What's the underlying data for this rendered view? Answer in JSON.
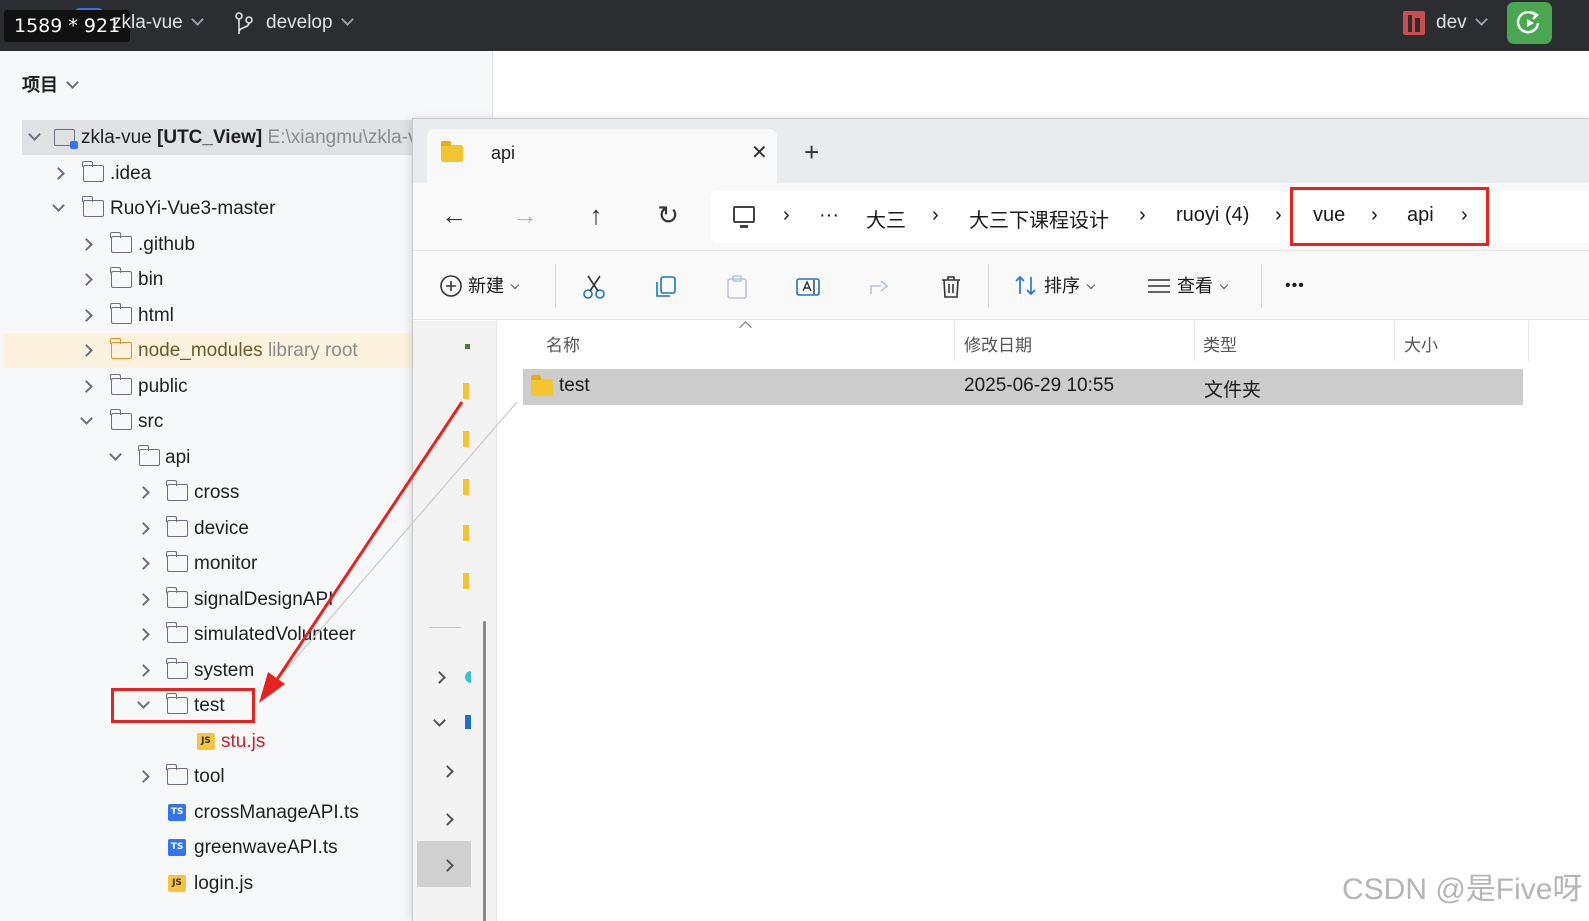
{
  "overlay": {
    "size_label": "1589 * 921"
  },
  "titlebar": {
    "project_name": "zkla-vue",
    "branch": "develop",
    "run_config": "dev",
    "icons": [
      "project-logo-icon",
      "branch-icon",
      "run-config-icon",
      "run-button-icon"
    ]
  },
  "project_panel": {
    "header": "项目",
    "tree": [
      {
        "name": "zkla-vue",
        "bold_suffix": "[UTC_View]",
        "path": "E:\\xiangmu\\zkla-v",
        "level": 0,
        "expanded": true,
        "selected": true
      },
      {
        "name": ".idea",
        "level": 1,
        "expanded": false
      },
      {
        "name": "RuoYi-Vue3-master",
        "level": 1,
        "expanded": true
      },
      {
        "name": ".github",
        "level": 2,
        "expanded": false
      },
      {
        "name": "bin",
        "level": 2,
        "expanded": false
      },
      {
        "name": "html",
        "level": 2,
        "expanded": false
      },
      {
        "name": "node_modules",
        "suffix": "library root",
        "level": 2,
        "expanded": false
      },
      {
        "name": "public",
        "level": 2,
        "expanded": false
      },
      {
        "name": "src",
        "level": 2,
        "expanded": true
      },
      {
        "name": "api",
        "level": 3,
        "expanded": true
      },
      {
        "name": "cross",
        "level": 4,
        "expanded": false
      },
      {
        "name": "device",
        "level": 4,
        "expanded": false
      },
      {
        "name": "monitor",
        "level": 4,
        "expanded": false
      },
      {
        "name": "signalDesignAPI",
        "level": 4,
        "expanded": false
      },
      {
        "name": "simulatedVolunteer",
        "level": 4,
        "expanded": false
      },
      {
        "name": "system",
        "level": 4,
        "expanded": false
      },
      {
        "name": "test",
        "level": 4,
        "expanded": true,
        "highlighted": true
      },
      {
        "name": "stu.js",
        "level": 5,
        "type": "js"
      },
      {
        "name": "tool",
        "level": 4,
        "expanded": false
      },
      {
        "name": "crossManageAPI.ts",
        "level": 4,
        "type": "ts"
      },
      {
        "name": "greenwaveAPI.ts",
        "level": 4,
        "type": "ts"
      },
      {
        "name": "login.js",
        "level": 4,
        "type": "js"
      }
    ]
  },
  "explorer": {
    "tab_title": "api",
    "new_tab_label": "+",
    "close_label": "✕",
    "nav": {
      "back": "←",
      "forward": "→",
      "up": "↑",
      "refresh": "↻"
    },
    "breadcrumb": [
      "大三",
      "大三下课程设计",
      "ruoyi (4)",
      "vue",
      "api"
    ],
    "breadcrumb_more": "···",
    "breadcrumb_sep": "›",
    "toolbar": {
      "new_label": "新建",
      "sort_label": "排序",
      "view_label": "查看",
      "more_label": "•••"
    },
    "columns": [
      "名称",
      "修改日期",
      "类型",
      "大小"
    ],
    "rows": [
      {
        "name": "test",
        "modified": "2025-06-29 10:55",
        "type": "文件夹",
        "size": ""
      }
    ]
  },
  "watermark": "CSDN @是Five呀",
  "colors": {
    "annotation_red": "#e8231f",
    "ide_dark": "#2b2d30",
    "accent_blue": "#3574f0",
    "folder_yellow": "#f4c430"
  }
}
